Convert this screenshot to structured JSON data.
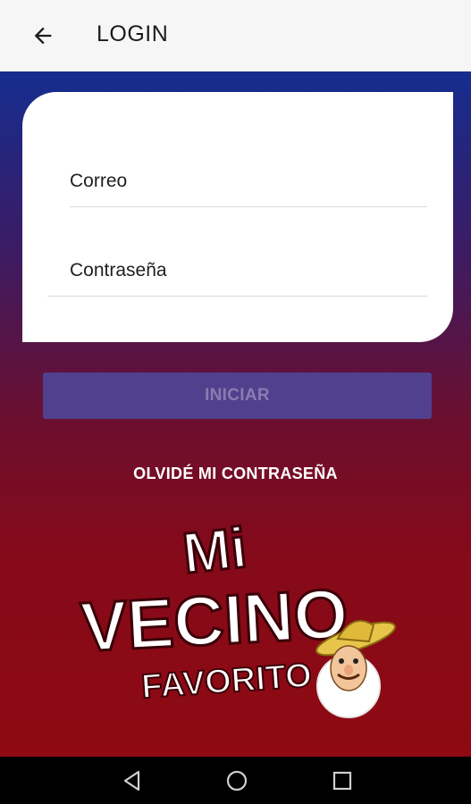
{
  "appbar": {
    "title": "LOGIN",
    "back_icon": "arrow-left-icon"
  },
  "form": {
    "email_label": "Correo",
    "password_label": "Contraseña",
    "submit_label": "INICIAR"
  },
  "forgot_password_label": "OLVIDÉ MI CONTRASEÑA",
  "logo": {
    "line1": "Mi",
    "line2": "VECINO",
    "line3": "FAVORITO",
    "mascot_icon": "sombrero-mascot-icon"
  },
  "navbar": {
    "back_icon": "triangle-back-icon",
    "home_icon": "circle-home-icon",
    "recents_icon": "square-recents-icon"
  },
  "colors": {
    "gradient_top": "#152d8f",
    "gradient_bottom": "#8f0a12",
    "button_bg": "#51408d",
    "button_text": "#8a7bb0"
  }
}
